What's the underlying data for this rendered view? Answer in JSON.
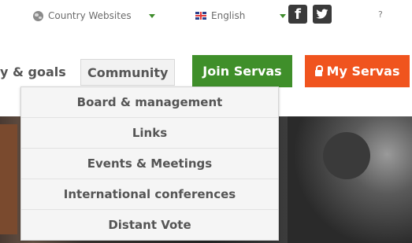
{
  "topbar": {
    "country_websites": "Country Websites",
    "language": "English",
    "facebook_glyph": "f",
    "help": "?"
  },
  "nav": {
    "goals_partial": "y & goals",
    "community": "Community"
  },
  "buttons": {
    "join": "Join Servas",
    "my_servas": "My Servas"
  },
  "dropdown": {
    "items": [
      "Board & management",
      "Links",
      "Events & Meetings",
      "International conferences",
      "Distant Vote"
    ]
  },
  "colors": {
    "join_green": "#3f8f2a",
    "my_servas_orange": "#f0541e",
    "caret_green": "#3d8b2a"
  },
  "icons": {
    "globe": "globe-icon",
    "flag": "uk-flag-icon",
    "facebook": "facebook-icon",
    "twitter": "twitter-icon",
    "lock": "lock-icon"
  }
}
